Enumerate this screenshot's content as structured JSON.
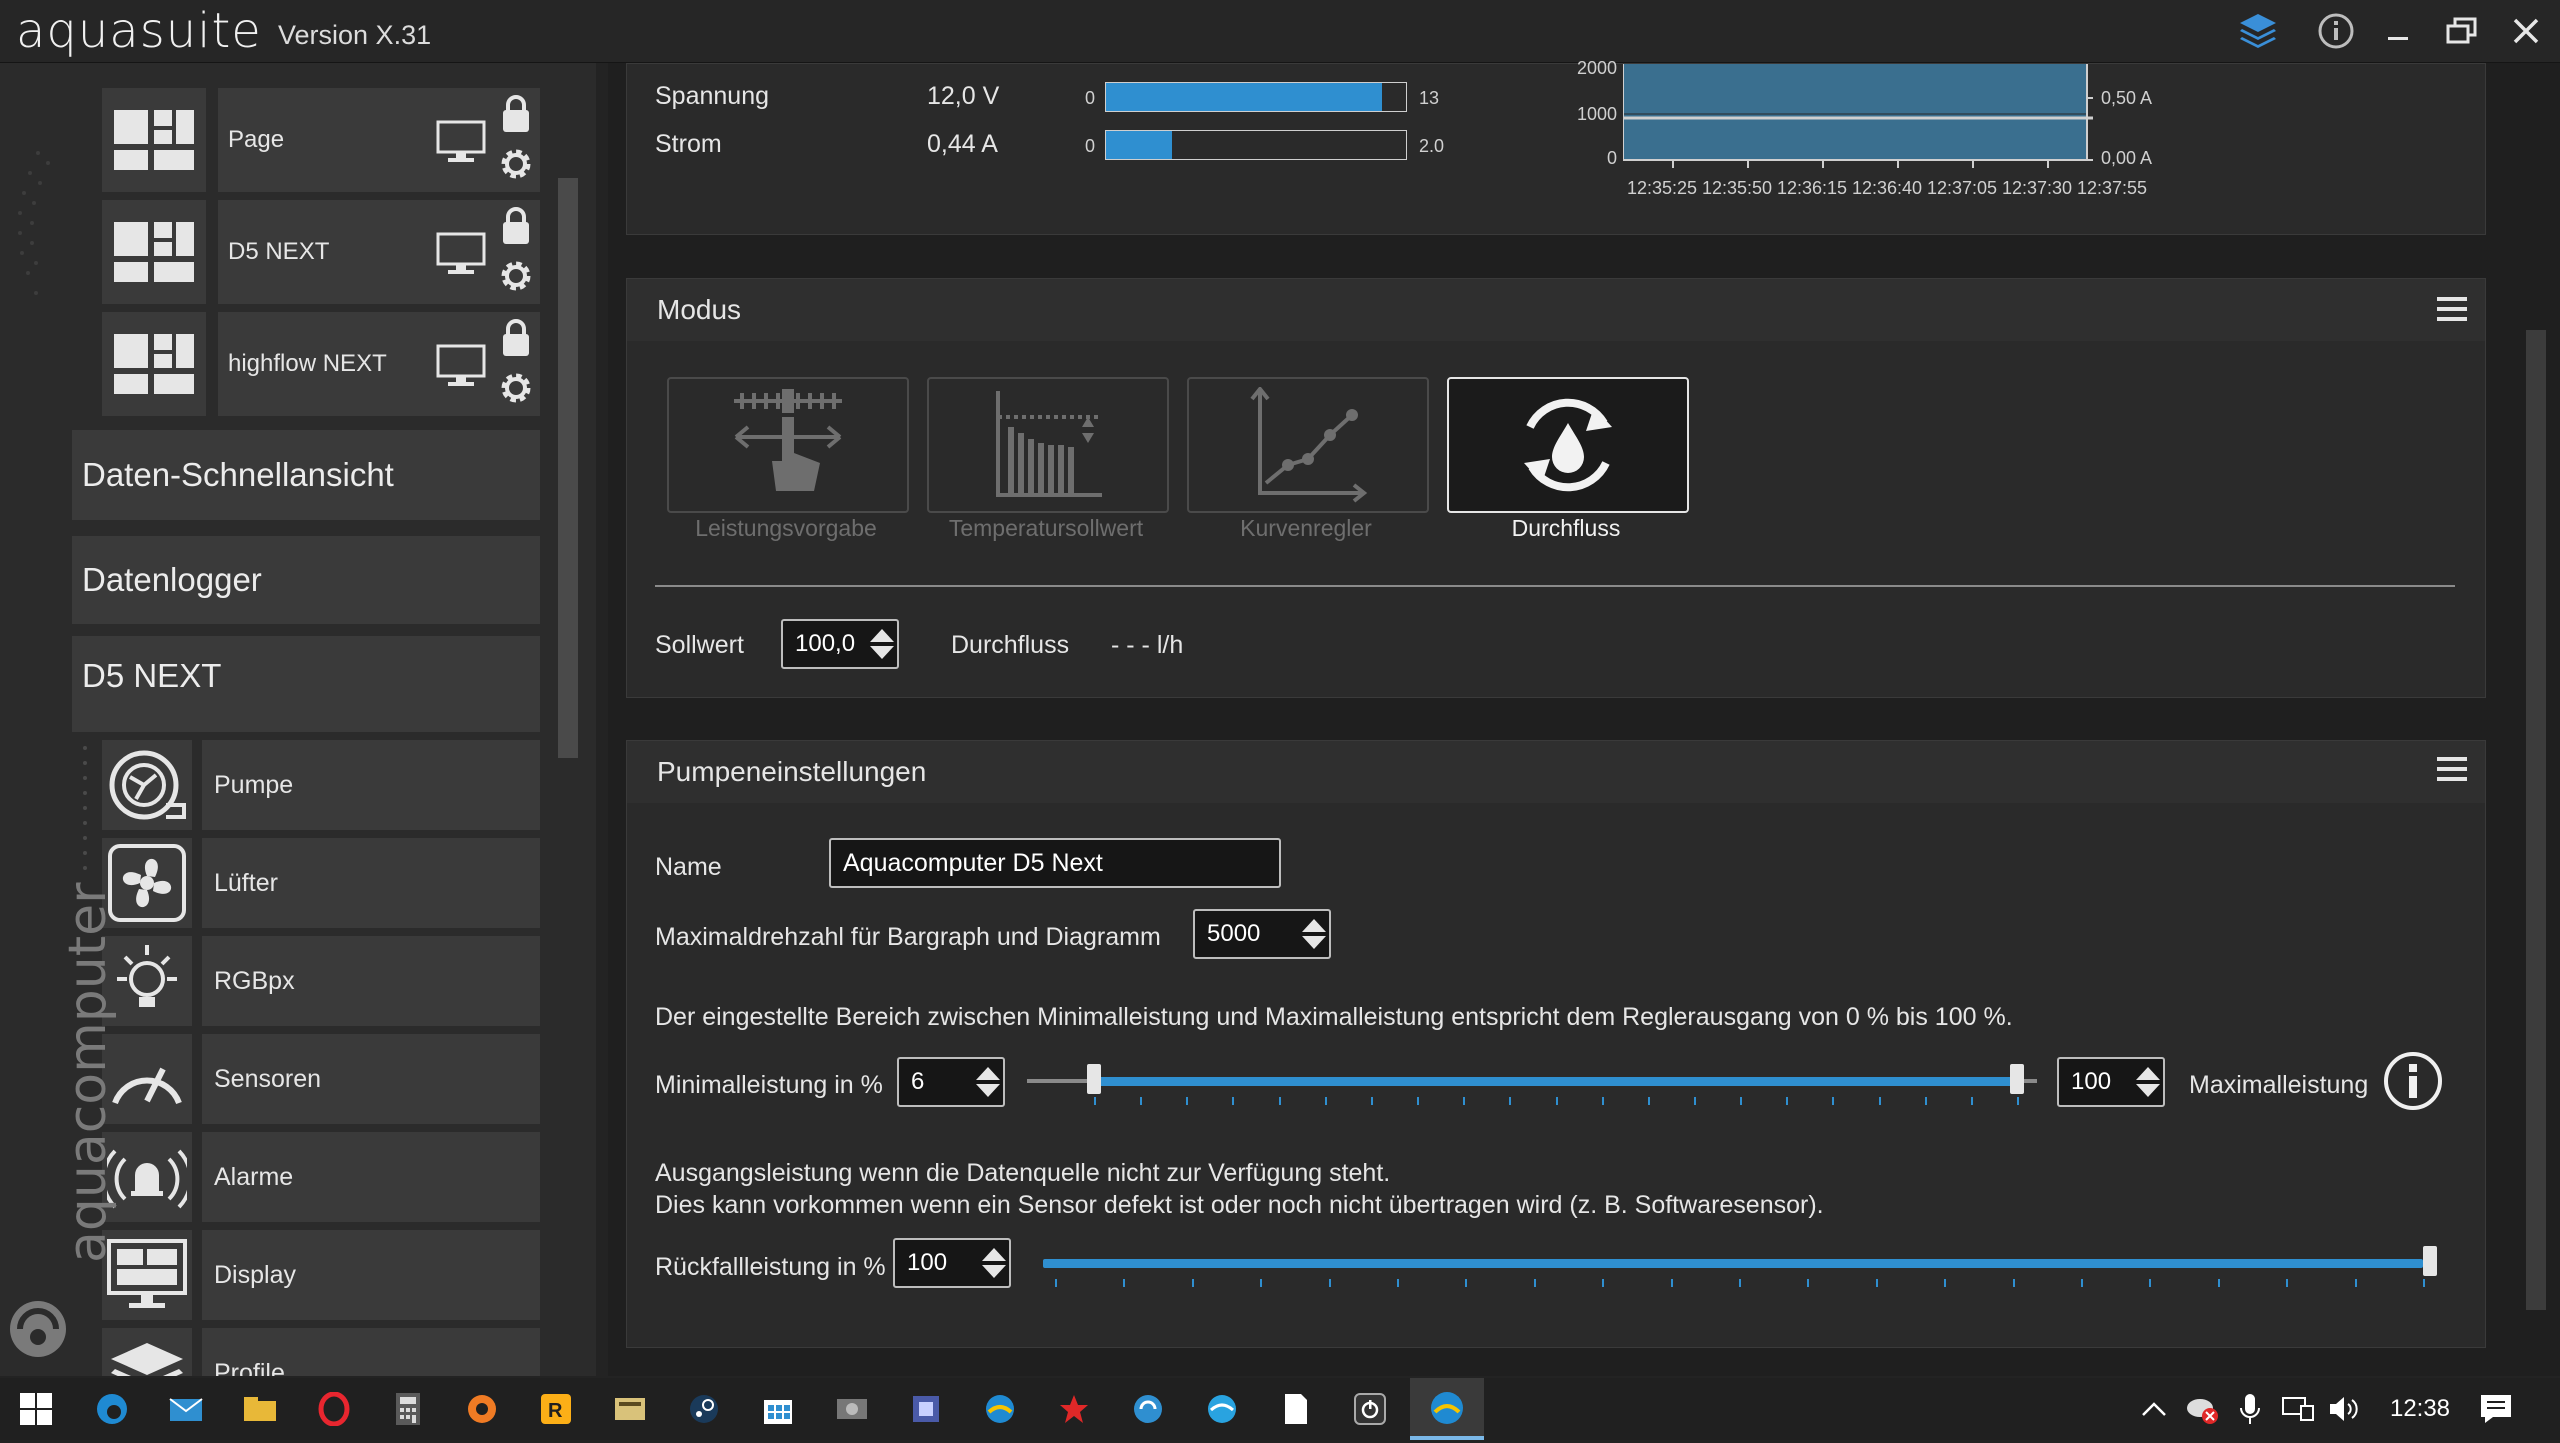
{
  "titlebar": {
    "app_name": "aquasuite",
    "version": "Version X.31"
  },
  "sidebar": {
    "brand_vertical": "aquacomputer",
    "pages": [
      {
        "label": "Page"
      },
      {
        "label": "D5 NEXT"
      },
      {
        "label": "highflow NEXT"
      }
    ],
    "sections": [
      {
        "label": "Daten-Schnellansicht"
      },
      {
        "label": "Datenlogger"
      },
      {
        "label": "D5 NEXT"
      }
    ],
    "nav_items": [
      {
        "label": "Pumpe",
        "icon": "pump-icon"
      },
      {
        "label": "Lüfter",
        "icon": "fan-icon"
      },
      {
        "label": "RGBpx",
        "icon": "lightbulb-icon"
      },
      {
        "label": "Sensoren",
        "icon": "gauge-icon"
      },
      {
        "label": "Alarme",
        "icon": "alarm-bell-icon"
      },
      {
        "label": "Display",
        "icon": "display-icon"
      },
      {
        "label": "Profile",
        "icon": "layers-icon"
      }
    ]
  },
  "overview": {
    "rows": [
      {
        "label": "Spannung",
        "value": "12,0 V",
        "bar_min": "0",
        "bar_max": "13",
        "fill_fraction": 0.92
      },
      {
        "label": "Strom",
        "value": "0,44 A",
        "bar_min": "0",
        "bar_max": "2.0",
        "fill_fraction": 0.22
      }
    ],
    "chart": {
      "y_left_ticks": [
        "2000",
        "1000",
        "0"
      ],
      "y_right_ticks": [
        "0,50 A",
        "0,00 A"
      ],
      "x_ticks": [
        "12:35:25",
        "12:35:50",
        "12:36:15",
        "12:36:40",
        "12:37:05",
        "12:37:30",
        "12:37:55"
      ]
    }
  },
  "modus": {
    "title": "Modus",
    "modes": [
      {
        "label": "Leistungsvorgabe",
        "icon": "power-setpoint-icon",
        "active": false
      },
      {
        "label": "Temperatursollwert",
        "icon": "temperature-setpoint-icon",
        "active": false
      },
      {
        "label": "Kurvenregler",
        "icon": "curve-controller-icon",
        "active": false
      },
      {
        "label": "Durchfluss",
        "icon": "flow-icon",
        "active": true
      }
    ],
    "sollwert_label": "Sollwert",
    "sollwert_value": "100,0",
    "durchfluss_label": "Durchfluss",
    "durchfluss_value": "- - - l/h"
  },
  "pump_settings": {
    "title": "Pumpeneinstellungen",
    "name_label": "Name",
    "name_value": "Aquacomputer D5 Next",
    "maxrpm_label": "Maximaldrehzahl für Bargraph und Diagramm",
    "maxrpm_value": "5000",
    "range_info": "Der eingestellte Bereich zwischen Minimalleistung und Maximalleistung entspricht dem Reglerausgang von 0 % bis 100 %.",
    "min_label": "Minimalleistung in %",
    "min_value": "6",
    "max_value": "100",
    "max_label": "Maximalleistung",
    "min_fraction": 0.06,
    "max_fraction": 1.0,
    "fallback_info_1": "Ausgangsleistung wenn die Datenquelle nicht zur Verfügung steht.",
    "fallback_info_2": "Dies kann vorkommen wenn ein Sensor defekt ist oder noch nicht übertragen wird (z. B. Softwaresensor).",
    "fallback_label": "Rückfallleistung in %",
    "fallback_value": "100",
    "fallback_fraction": 1.0
  },
  "taskbar": {
    "time": "12:38"
  },
  "colors": {
    "accent": "#2f8fd0",
    "background": "#232323",
    "panel": "#2a2a2a"
  }
}
